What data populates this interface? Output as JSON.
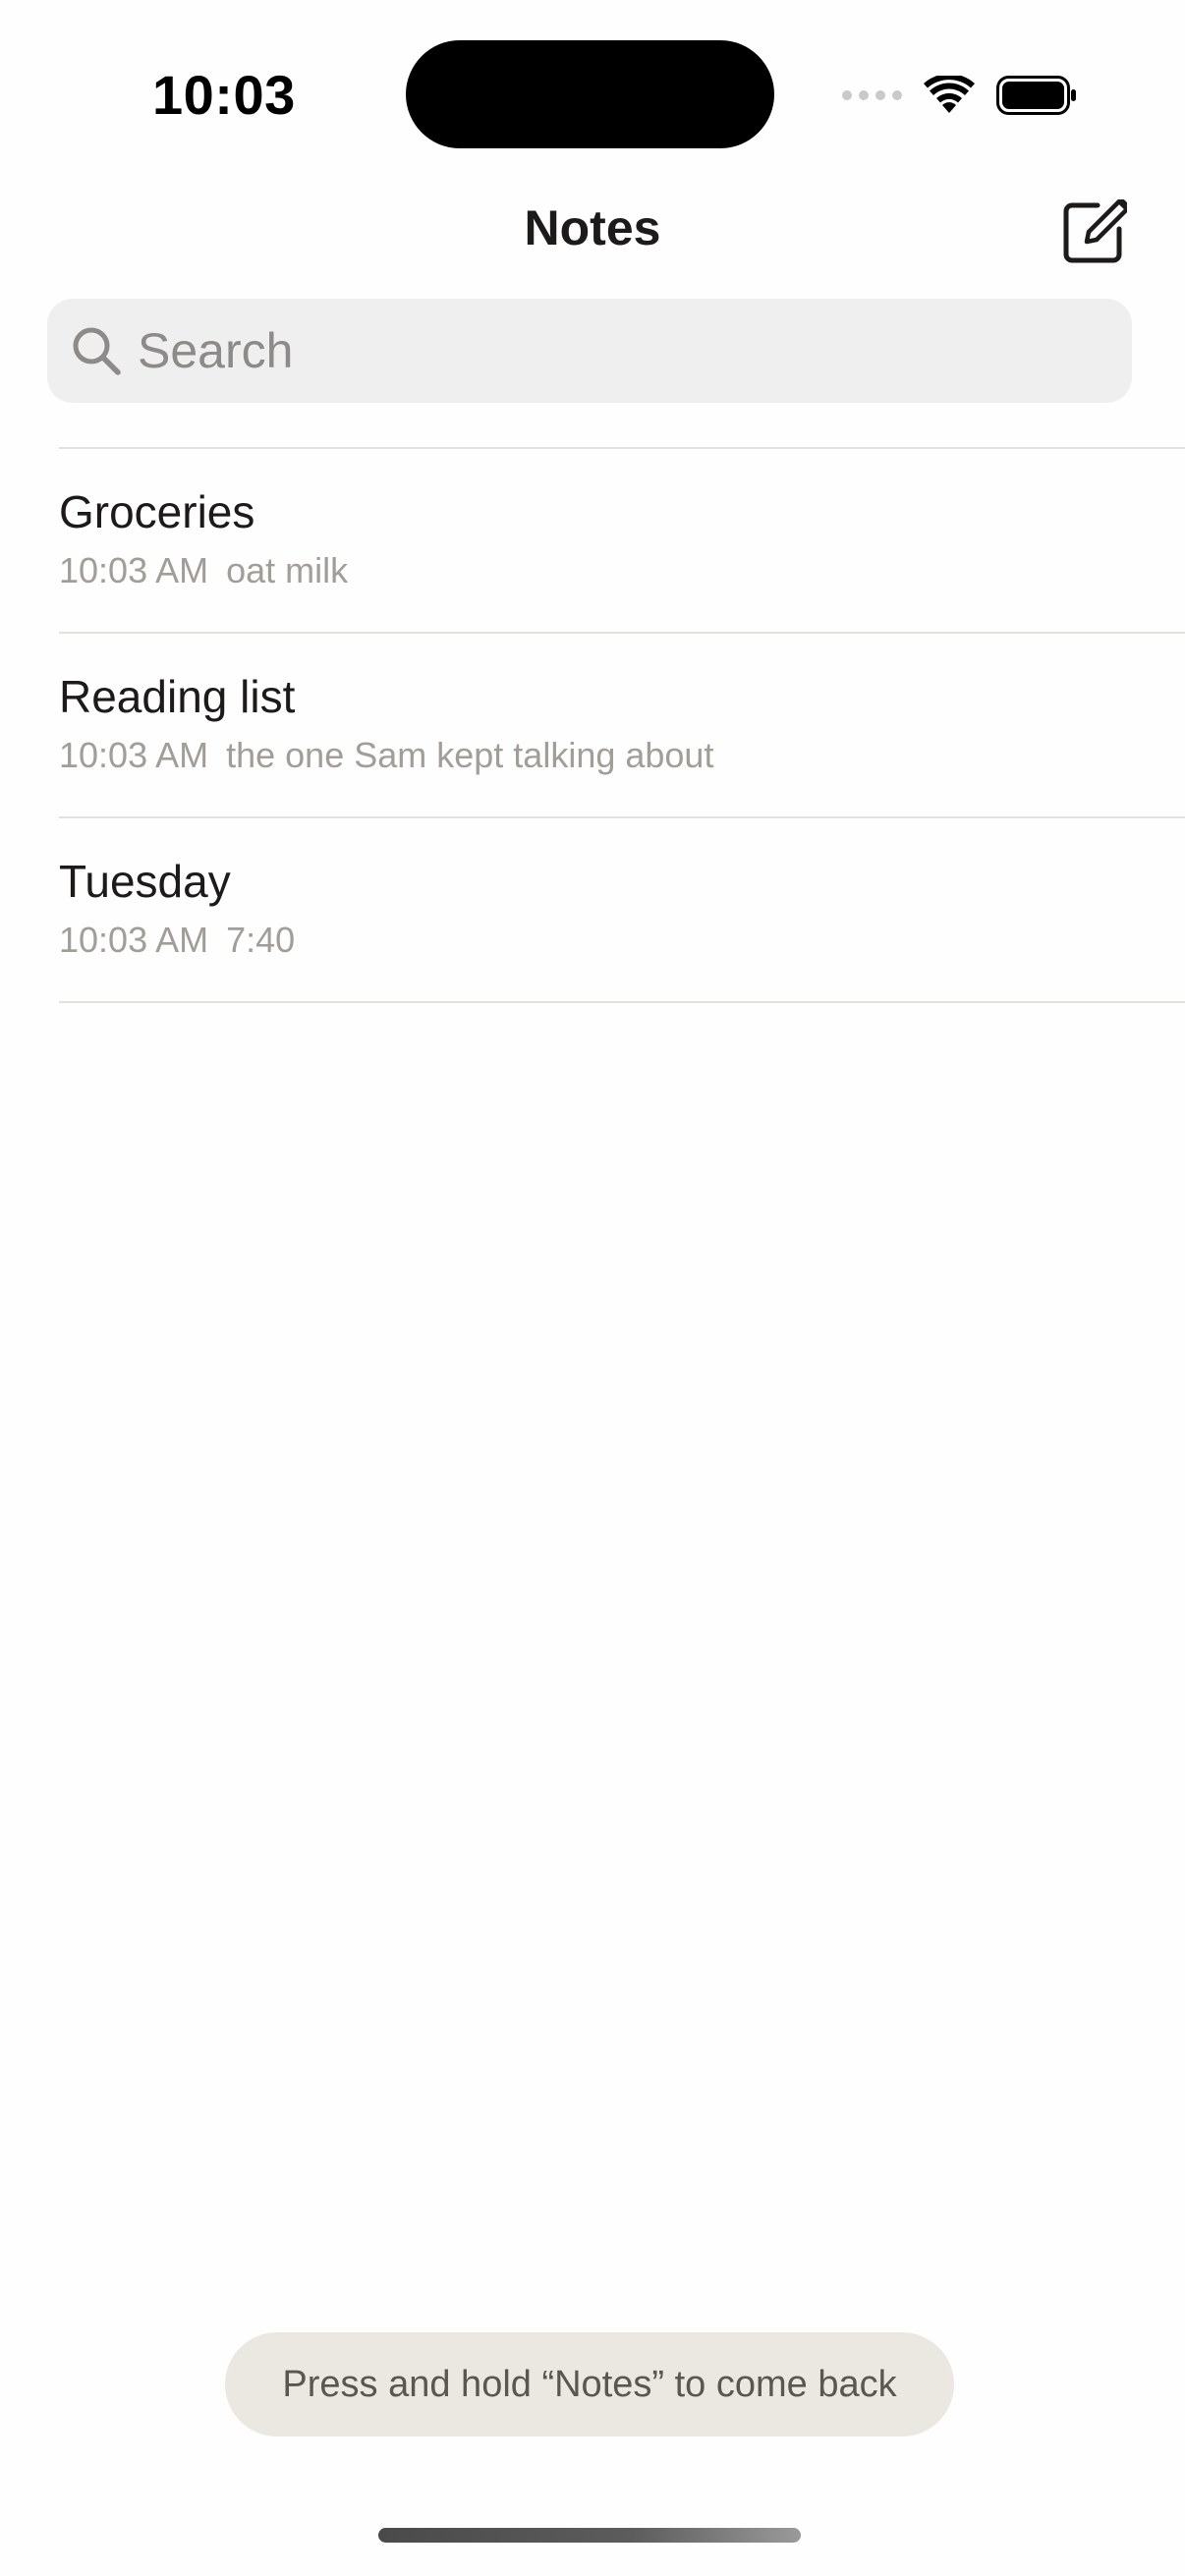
{
  "status_bar": {
    "time": "10:03"
  },
  "nav": {
    "title": "Notes",
    "compose_icon": "compose-icon"
  },
  "search": {
    "placeholder": "Search",
    "value": "",
    "icon": "search-icon"
  },
  "notes": [
    {
      "title": "Groceries",
      "time": "10:03 AM",
      "preview": "oat milk"
    },
    {
      "title": "Reading list",
      "time": "10:03 AM",
      "preview": "the one Sam kept talking about"
    },
    {
      "title": "Tuesday",
      "time": "10:03 AM",
      "preview": "7:40"
    }
  ],
  "toast": {
    "text": "Press and hold “Notes” to come back"
  },
  "colors": {
    "background": "#fefefe",
    "text_primary": "#1c1b1a",
    "text_secondary": "#a29d97",
    "search_bg": "#efefef",
    "divider": "#e3e1de",
    "toast_bg": "#ebe8e2"
  }
}
